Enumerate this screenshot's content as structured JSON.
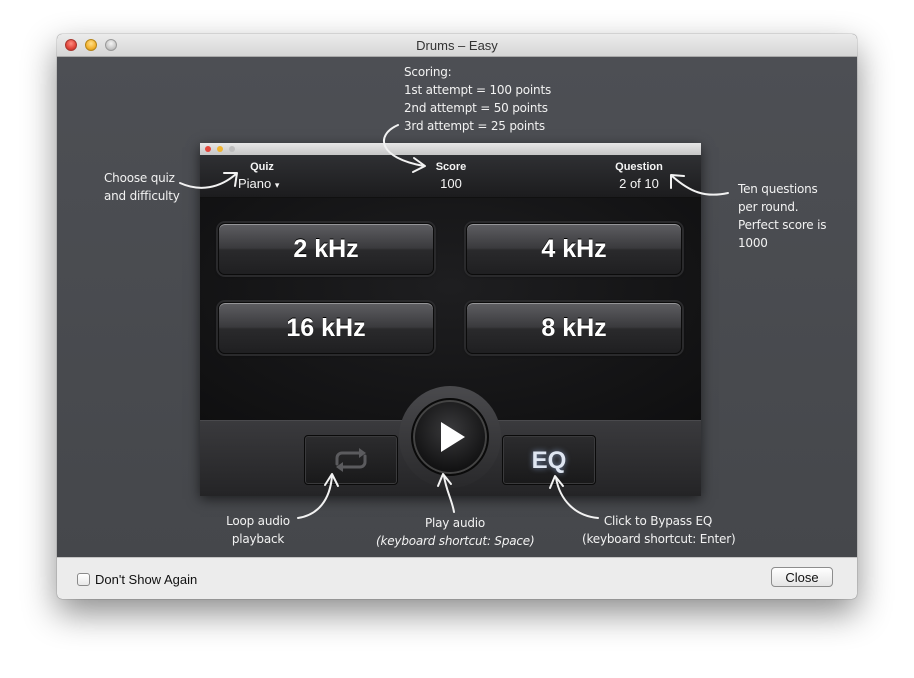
{
  "window": {
    "title": "Drums – Easy"
  },
  "app": {
    "header": {
      "quiz_label": "Quiz",
      "quiz_value": "Piano",
      "quiz_caret": "▾",
      "score_label": "Score",
      "score_value": "100",
      "question_label": "Question",
      "question_value": "2 of 10"
    },
    "answers": [
      "2 kHz",
      "4 kHz",
      "16 kHz",
      "8 kHz"
    ],
    "controls": {
      "loop_icon": "loop-icon",
      "play_icon": "play-icon",
      "eq_label": "EQ"
    }
  },
  "annotations": {
    "scoring": [
      "Scoring:",
      "1st attempt = 100 points",
      "2nd attempt = 50 points",
      "3rd attempt = 25 points"
    ],
    "quiz": [
      "Choose quiz",
      "and difficulty"
    ],
    "question": [
      "Ten questions",
      "per round.",
      "Perfect score is",
      "1000"
    ],
    "loop": [
      "Loop audio",
      "playback"
    ],
    "play": [
      "Play audio",
      "(keyboard shortcut: Space)"
    ],
    "eq": [
      "Click to Bypass EQ",
      "(keyboard shortcut: Enter)"
    ]
  },
  "footer": {
    "dont_show_label": "Don't Show Again",
    "close_label": "Close"
  },
  "colors": {
    "window_bg": "#4a4c50",
    "app_bg": "#202022",
    "button_text": "#ffffff",
    "annotation_text": "#f2f2f2"
  }
}
